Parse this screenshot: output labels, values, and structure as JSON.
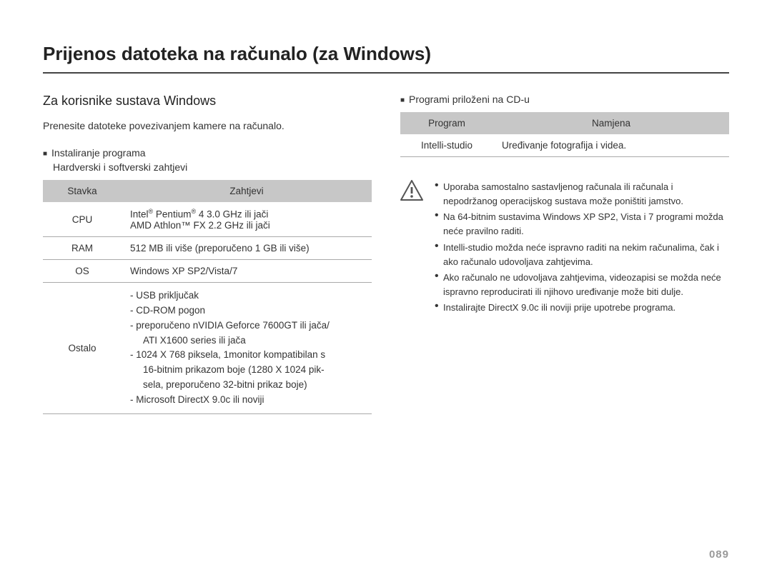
{
  "page_title": "Prijenos datoteka na računalo (za Windows)",
  "page_number": "089",
  "left": {
    "section_heading": "Za korisnike sustava Windows",
    "intro": "Prenesite datoteke povezivanjem kamere na računalo.",
    "install_heading": "Instaliranje programa",
    "install_sub": "Hardverski i softverski zahtjevi",
    "table": {
      "head_item": "Stavka",
      "head_req": "Zahtjevi",
      "rows": {
        "cpu_label": "CPU",
        "cpu_line1_a": "Intel",
        "cpu_line1_b": " Pentium",
        "cpu_line1_c": " 4 3.0 GHz ili jači",
        "cpu_line2": "AMD Athlon™ FX 2.2 GHz ili jači",
        "ram_label": "RAM",
        "ram_req": "512 MB ili više (preporučeno 1 GB ili više)",
        "os_label": "OS",
        "os_req": "Windows XP SP2/Vista/7",
        "other_label": "Ostalo",
        "other_l1": "- USB priključak",
        "other_l2": "- CD-ROM pogon",
        "other_l3": "- preporučeno nVIDIA Geforce 7600GT ili jača/",
        "other_l3b": "ATI X1600 series ili jača",
        "other_l4": "- 1024 X 768 piksela, 1monitor kompatibilan s",
        "other_l4b": "16-bitnim prikazom boje (1280 X 1024 pik-",
        "other_l4c": "sela, preporučeno 32-bitni prikaz boje)",
        "other_l5": "- Microsoft DirectX 9.0c ili noviji"
      }
    }
  },
  "right": {
    "programs_heading": "Programi priloženi na CD-u",
    "table": {
      "head_prog": "Program",
      "head_purpose": "Namjena",
      "row_prog": "Intelli-studio",
      "row_purpose": "Uređivanje fotografija i videa."
    },
    "warnings": [
      "Uporaba samostalno sastavljenog računala ili računala i nepodržanog operacijskog sustava može poništiti jamstvo.",
      "Na 64-bitnim sustavima Windows XP SP2, Vista i 7 programi možda neće pravilno raditi.",
      "Intelli-studio možda neće ispravno raditi na nekim računalima, čak i ako računalo udovoljava zahtjevima.",
      "Ako računalo ne udovoljava zahtjevima, videozapisi se možda neće ispravno reproducirati ili njihovo uređivanje može biti dulje.",
      "Instalirajte DirectX 9.0c ili noviji prije upotrebe programa."
    ]
  }
}
